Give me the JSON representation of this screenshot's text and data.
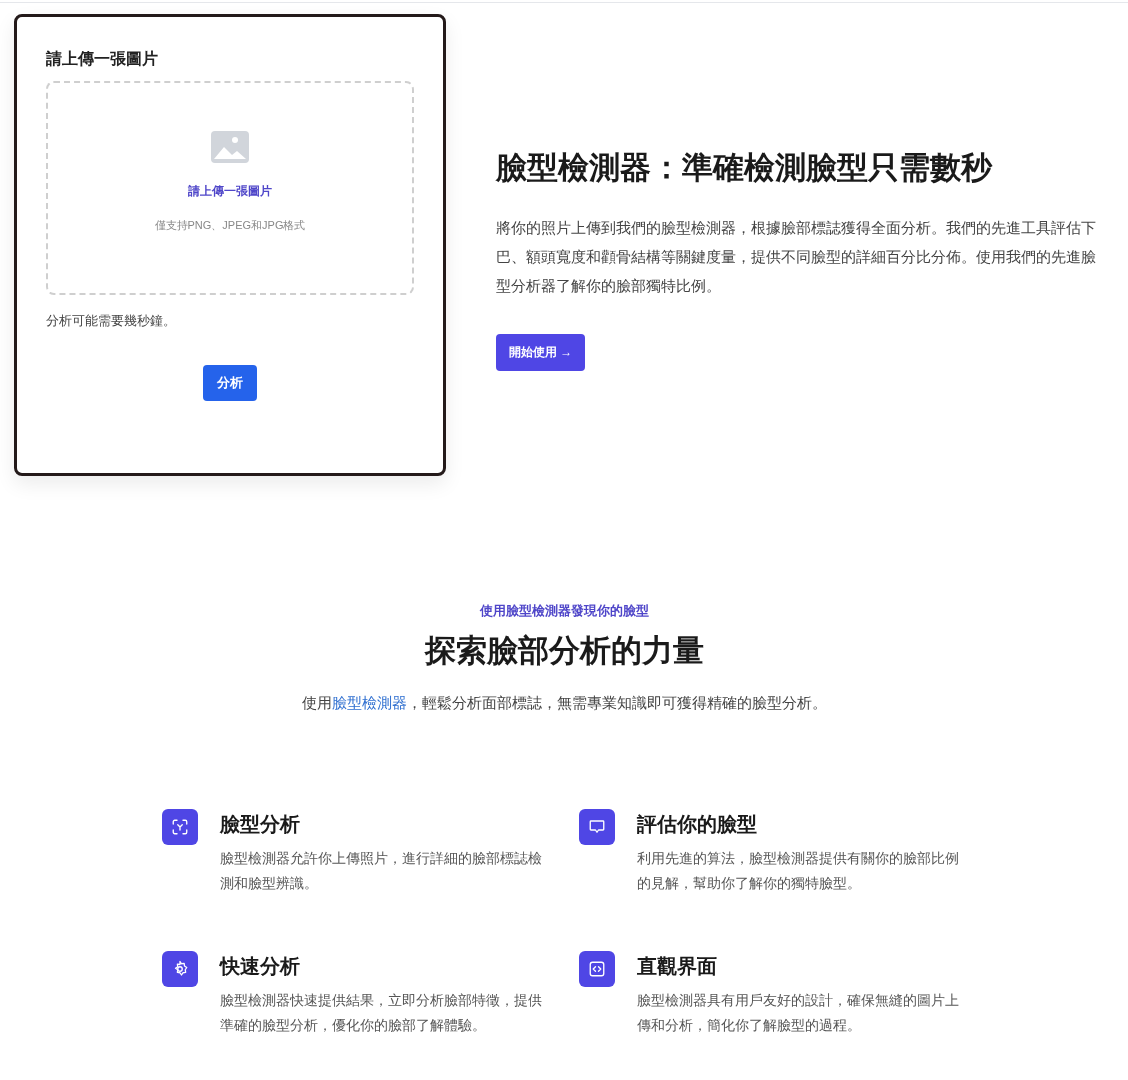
{
  "upload_card": {
    "heading": "請上傳一張圖片",
    "dropzone": {
      "prompt": "請上傳一張圖片",
      "formats": "僅支持PNG、JPEG和JPG格式"
    },
    "note": "分析可能需要幾秒鐘。",
    "button": "分析"
  },
  "hero": {
    "title": "臉型檢測器：準確檢測臉型只需數秒",
    "description": "將你的照片上傳到我們的臉型檢測器，根據臉部標誌獲得全面分析。我們的先進工具評估下巴、額頭寬度和顴骨結構等關鍵度量，提供不同臉型的詳細百分比分佈。使用我們的先進臉型分析器了解你的臉部獨特比例。",
    "button": "開始使用",
    "button_icon": "→"
  },
  "features_section": {
    "eyebrow": "使用臉型檢測器發現你的臉型",
    "title": "探索臉部分析的力量",
    "intro": {
      "before": "使用",
      "link": "臉型檢測器",
      "after": "，輕鬆分析面部標誌，無需專業知識即可獲得精確的臉型分析。"
    },
    "features": [
      {
        "kind": "scan",
        "title": "臉型分析",
        "description": "臉型檢測器允許你上傳照片，進行詳細的臉部標誌檢測和臉型辨識。"
      },
      {
        "kind": "chat",
        "title": "評估你的臉型",
        "description": "利用先進的算法，臉型檢測器提供有關你的臉部比例的見解，幫助你了解你的獨特臉型。"
      },
      {
        "kind": "gear",
        "title": "快速分析",
        "description": "臉型檢測器快速提供結果，立即分析臉部特徵，提供準確的臉型分析，優化你的臉部了解體驗。"
      },
      {
        "kind": "code",
        "title": "直觀界面",
        "description": "臉型檢測器具有用戶友好的設計，確保無縫的圖片上傳和分析，簡化你了解臉型的過程。"
      }
    ]
  }
}
